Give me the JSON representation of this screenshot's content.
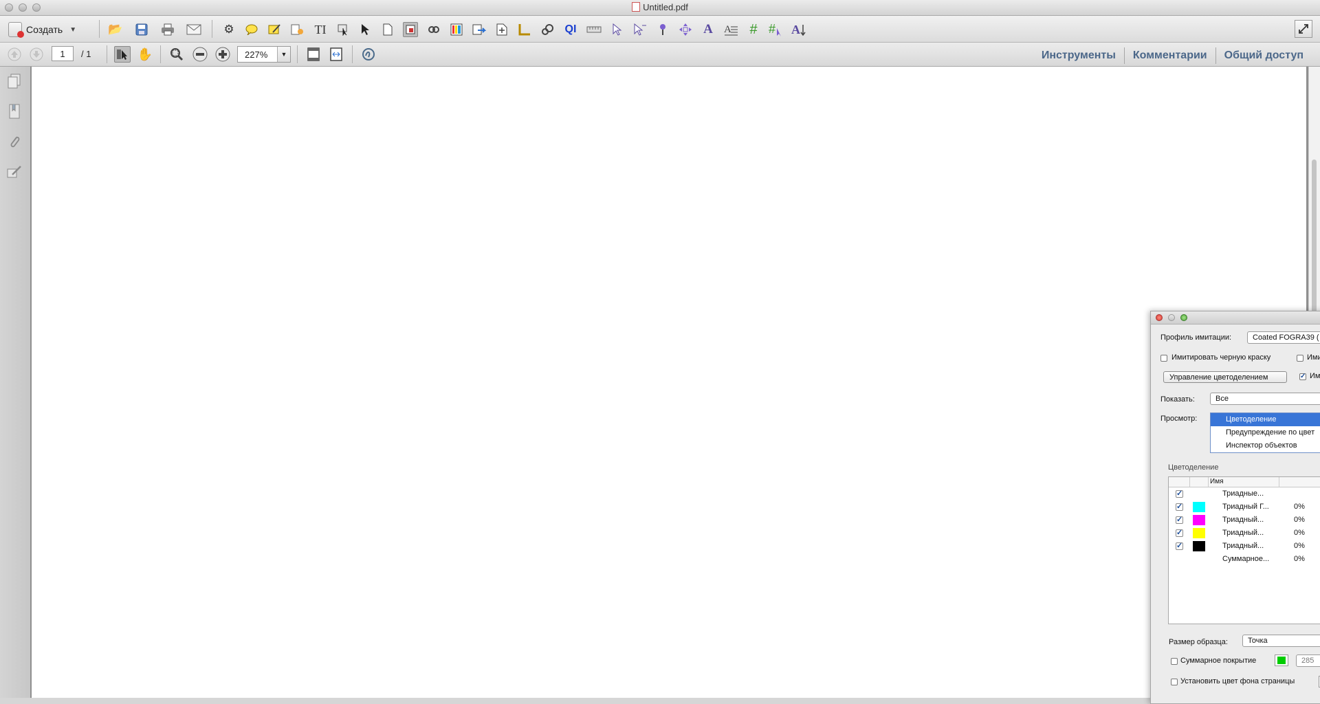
{
  "window": {
    "title": "Untitled.pdf"
  },
  "toolbar": {
    "create_label": "Создать"
  },
  "nav": {
    "page_current": "1",
    "page_total": "/ 1",
    "zoom": "227%"
  },
  "right_tabs": [
    "Инструменты",
    "Комментарии",
    "Общий доступ"
  ],
  "panel": {
    "profile_label": "Профиль имитации:",
    "profile_value": "Coated FOGRA39 (",
    "simulate_black_label": "Имитировать черную краску",
    "simulate_paper_label_partial": "Ими",
    "color_mgmt_button": "Управление цветоделением",
    "cut_label": "Им",
    "show_label": "Показать:",
    "show_value": "Все",
    "preview_label": "Просмотр:",
    "preview_options": [
      "Цветоделение",
      "Предупреждение по цвет",
      "Инспектор объектов"
    ],
    "preview_selected": "Цветоделение",
    "separations_title": "Цветоделение",
    "table_header_name": "Имя",
    "separations": [
      {
        "name": "Триадные...",
        "percent": "",
        "checked": true,
        "swatch": ""
      },
      {
        "name": "Триадный Г...",
        "percent": "0%",
        "checked": true,
        "swatch": "#00ffff"
      },
      {
        "name": "Триадный...",
        "percent": "0%",
        "checked": true,
        "swatch": "#ff00ff"
      },
      {
        "name": "Триадный...",
        "percent": "0%",
        "checked": true,
        "swatch": "#ffff00"
      },
      {
        "name": "Триадный...",
        "percent": "0%",
        "checked": true,
        "swatch": "#000000"
      },
      {
        "name": "Суммарное...",
        "percent": "0%",
        "checked": false,
        "swatch": ""
      }
    ],
    "sample_size_label": "Размер образца:",
    "sample_size_value": "Точка",
    "total_coverage_label": "Суммарное покрытие",
    "total_coverage_value": "285",
    "total_coverage_color": "#00cc00",
    "page_bg_label": "Установить цвет фона страницы"
  }
}
